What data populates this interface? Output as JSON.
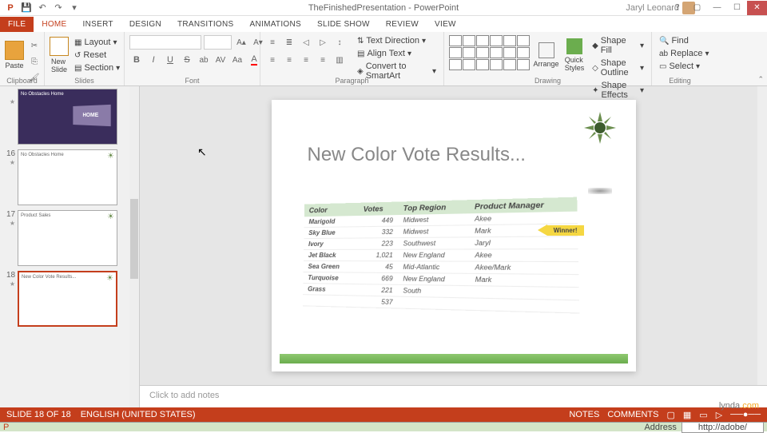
{
  "app": {
    "title": "TheFinishedPresentation - PowerPoint",
    "user": "Jaryl Leonard"
  },
  "tabs": {
    "file": "FILE",
    "home": "HOME",
    "insert": "INSERT",
    "design": "DESIGN",
    "transitions": "TRANSITIONS",
    "animations": "ANIMATIONS",
    "slideshow": "SLIDE SHOW",
    "review": "REVIEW",
    "view": "VIEW"
  },
  "ribbon": {
    "clipboard": {
      "label": "Clipboard",
      "paste": "Paste"
    },
    "slides": {
      "label": "Slides",
      "newslide": "New\nSlide",
      "layout": "Layout",
      "reset": "Reset",
      "section": "Section"
    },
    "font": {
      "label": "Font"
    },
    "paragraph": {
      "label": "Paragraph",
      "textdir": "Text Direction",
      "align": "Align Text",
      "smartart": "Convert to SmartArt"
    },
    "drawing": {
      "label": "Drawing",
      "arrange": "Arrange",
      "quick": "Quick\nStyles",
      "fill": "Shape Fill",
      "outline": "Shape Outline",
      "effects": "Shape Effects"
    },
    "editing": {
      "label": "Editing",
      "find": "Find",
      "replace": "Replace",
      "select": "Select"
    }
  },
  "thumbs": [
    {
      "num": "",
      "title": "No Obstacles Home",
      "dark": true
    },
    {
      "num": "16",
      "title": "No Obstacles Home",
      "dark": false
    },
    {
      "num": "17",
      "title": "Product Sales",
      "dark": false
    },
    {
      "num": "18",
      "title": "New Color Vote Results...",
      "dark": false,
      "selected": true
    }
  ],
  "slide": {
    "title": "New Color Vote Results...",
    "winner": "Winner!",
    "headers": [
      "Color",
      "Votes",
      "Top Region",
      "Product Manager"
    ],
    "rows": [
      [
        "Marigold",
        "449",
        "Midwest",
        "Akee"
      ],
      [
        "Sky Blue",
        "332",
        "Midwest",
        "Mark"
      ],
      [
        "Ivory",
        "223",
        "Southwest",
        "Jaryl"
      ],
      [
        "Jet Black",
        "1,021",
        "New England",
        "Akee"
      ],
      [
        "Sea Green",
        "45",
        "Mid-Atlantic",
        "Akee/Mark"
      ],
      [
        "Turquoise",
        "669",
        "New England",
        "Mark"
      ],
      [
        "Grass",
        "221",
        "South",
        ""
      ],
      [
        "",
        "537",
        "",
        ""
      ]
    ]
  },
  "notes": {
    "placeholder": "Click to add notes"
  },
  "status": {
    "slide": "SLIDE 18 OF 18",
    "lang": "ENGLISH (UNITED STATES)",
    "notes": "NOTES",
    "comments": "COMMENTS"
  },
  "taskbar": {
    "address": "Address",
    "url": "http://adobe/"
  },
  "watermark": {
    "brand": "lynda",
    "tld": ".com"
  },
  "chart_data": {
    "type": "table",
    "title": "New Color Vote Results...",
    "columns": [
      "Color",
      "Votes",
      "Top Region",
      "Product Manager"
    ],
    "rows": [
      {
        "Color": "Marigold",
        "Votes": 449,
        "Top Region": "Midwest",
        "Product Manager": "Akee"
      },
      {
        "Color": "Sky Blue",
        "Votes": 332,
        "Top Region": "Midwest",
        "Product Manager": "Mark"
      },
      {
        "Color": "Ivory",
        "Votes": 223,
        "Top Region": "Southwest",
        "Product Manager": "Jaryl",
        "Winner": true
      },
      {
        "Color": "Jet Black",
        "Votes": 1021,
        "Top Region": "New England",
        "Product Manager": "Akee"
      },
      {
        "Color": "Sea Green",
        "Votes": 45,
        "Top Region": "Mid-Atlantic",
        "Product Manager": "Akee/Mark"
      },
      {
        "Color": "Turquoise",
        "Votes": 669,
        "Top Region": "New England",
        "Product Manager": "Mark"
      },
      {
        "Color": "Grass",
        "Votes": 221,
        "Top Region": "South",
        "Product Manager": ""
      }
    ]
  }
}
